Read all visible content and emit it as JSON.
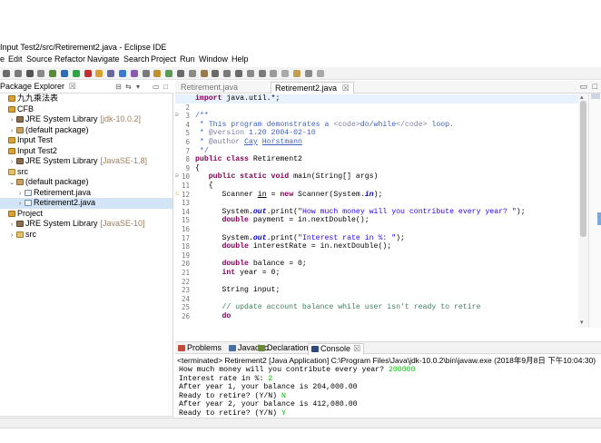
{
  "window": {
    "title": "Input Test2/src/Retirement2.java - Eclipse IDE"
  },
  "menubar": {
    "items": [
      "e",
      "Edit",
      "Source",
      "Refactor",
      "Navigate",
      "Search",
      "Project",
      "Run",
      "Window",
      "Help"
    ]
  },
  "package_explorer": {
    "title": "Package Explorer",
    "close": "☒",
    "tree": [
      {
        "label": "九九乘法表",
        "decor": "",
        "level": 0,
        "expand": "",
        "icon": "project"
      },
      {
        "label": "CFB",
        "decor": "",
        "level": 0,
        "expand": "",
        "icon": "project"
      },
      {
        "label": "JRE System Library",
        "decor": "[jdk-10.0.2]",
        "level": 1,
        "expand": "›",
        "icon": "library"
      },
      {
        "label": "(default package)",
        "decor": "",
        "level": 1,
        "expand": "›",
        "icon": "package"
      },
      {
        "label": "Input Test",
        "decor": "",
        "level": 0,
        "expand": "",
        "icon": "project"
      },
      {
        "label": "Input Test2",
        "decor": "",
        "level": 0,
        "expand": "",
        "icon": "project"
      },
      {
        "label": "JRE System Library",
        "decor": "[JavaSE-1.8]",
        "level": 1,
        "expand": "›",
        "icon": "library"
      },
      {
        "label": "src",
        "decor": "",
        "level": 0,
        "expand": "",
        "icon": "src"
      },
      {
        "label": "(default package)",
        "decor": "",
        "level": 1,
        "expand": "⌄",
        "icon": "package"
      },
      {
        "label": "Retirement.java",
        "decor": "",
        "level": 2,
        "expand": "›",
        "icon": "java"
      },
      {
        "label": "Retirement2.java",
        "decor": "",
        "level": 2,
        "expand": "›",
        "icon": "java",
        "selected": true
      },
      {
        "label": "Project",
        "decor": "",
        "level": 0,
        "expand": "",
        "icon": "project"
      },
      {
        "label": "JRE System Library",
        "decor": "[JavaSE-10]",
        "level": 1,
        "expand": "›",
        "icon": "library"
      },
      {
        "label": "src",
        "decor": "",
        "level": 1,
        "expand": "›",
        "icon": "src"
      }
    ]
  },
  "editor": {
    "tabs": [
      {
        "label": "Retirement.java",
        "active": false
      },
      {
        "label": "Retirement2.java",
        "active": true,
        "close": "☒"
      }
    ],
    "lines": [
      {
        "n": "1",
        "mark": "",
        "html": "<span class='kw'>import</span> java.util.*;",
        "hl": true
      },
      {
        "n": "2",
        "mark": "",
        "html": ""
      },
      {
        "n": "3",
        "mark": "⊖",
        "html": "<span class='jd'>/**</span>"
      },
      {
        "n": "4",
        "mark": "",
        "html": "<span class='jd'> * This program demonstrates a </span><span class='jt'>&lt;code&gt;</span><span class='jd'>do/while</span><span class='jt'>&lt;/code&gt;</span><span class='jd'> loop.</span>"
      },
      {
        "n": "5",
        "mark": "",
        "html": "<span class='jd'> * </span><span class='jt'>@version</span><span class='jd'> 1.20 2004-02-10</span>"
      },
      {
        "n": "6",
        "mark": "",
        "html": "<span class='jd'> * </span><span class='jt'>@author</span><span class='jd'> <u>Cay</u> <u>Horstmann</u></span>"
      },
      {
        "n": "7",
        "mark": "",
        "html": "<span class='jd'> */</span>"
      },
      {
        "n": "8",
        "mark": "",
        "html": "<span class='kw'>public class</span> Retirement2"
      },
      {
        "n": "9",
        "mark": "",
        "html": "{"
      },
      {
        "n": "10",
        "mark": "⊖",
        "html": "   <span class='kw'>public static void</span> main(String[] args)"
      },
      {
        "n": "11",
        "mark": "",
        "html": "   {"
      },
      {
        "n": "12",
        "mark": "⚠",
        "html": "      Scanner <u>in</u> = <span class='kw'>new</span> Scanner(System.<span class='fi'>in</span>);"
      },
      {
        "n": "13",
        "mark": "",
        "html": ""
      },
      {
        "n": "14",
        "mark": "",
        "html": "      System.<span class='fi'>out</span>.print(<span class='st'>\"How much money will you contribute every year? \"</span>);"
      },
      {
        "n": "15",
        "mark": "",
        "html": "      <span class='kw'>double</span> payment = in.nextDouble();"
      },
      {
        "n": "16",
        "mark": "",
        "html": ""
      },
      {
        "n": "17",
        "mark": "",
        "html": "      System.<span class='fi'>out</span>.print(<span class='st'>\"Interest rate in %: \"</span>);"
      },
      {
        "n": "18",
        "mark": "",
        "html": "      <span class='kw'>double</span> interestRate = in.nextDouble();"
      },
      {
        "n": "19",
        "mark": "",
        "html": ""
      },
      {
        "n": "20",
        "mark": "",
        "html": "      <span class='kw'>double</span> balance = 0;"
      },
      {
        "n": "21",
        "mark": "",
        "html": "      <span class='kw'>int</span> year = 0;"
      },
      {
        "n": "22",
        "mark": "",
        "html": ""
      },
      {
        "n": "23",
        "mark": "",
        "html": "      String input;"
      },
      {
        "n": "24",
        "mark": "",
        "html": ""
      },
      {
        "n": "25",
        "mark": "",
        "html": "      <span class='cm'>// update account balance while user isn't ready to retire</span>"
      },
      {
        "n": "26",
        "mark": "",
        "html": "      <span class='kw'>do</span>"
      }
    ]
  },
  "console_panel": {
    "tabs": [
      {
        "label": "Problems",
        "active": false,
        "color": "#c24a3b"
      },
      {
        "label": "Javadoc",
        "active": false,
        "color": "#4a6fa5"
      },
      {
        "label": "Declaration",
        "active": false,
        "color": "#6a8a3a"
      },
      {
        "label": "Console",
        "active": true,
        "color": "#2c4a7a",
        "close": "☒"
      }
    ],
    "header": "<terminated> Retirement2 [Java Application] C:\\Program Files\\Java\\jdk-10.0.2\\bin\\javaw.exe (2018年9月8日 下午10:04:30)",
    "lines": [
      {
        "text": "How much money will you contribute every year? ",
        "input": "200000"
      },
      {
        "text": "Interest rate in %: ",
        "input": "2"
      },
      {
        "text": "After year 1, your balance is 204,000.00",
        "input": ""
      },
      {
        "text": "Ready to retire? (Y/N) ",
        "input": "N"
      },
      {
        "text": "After year 2, your balance is 412,080.00",
        "input": ""
      },
      {
        "text": "Ready to retire? (Y/N) ",
        "input": "Y"
      }
    ]
  },
  "colors": {
    "keyword": "#7f0055",
    "string": "#2a00ff",
    "comment": "#3f7f5f",
    "javadoc": "#3f5fbf",
    "console_input": "#00c800",
    "selection": "#d4e4f7"
  }
}
